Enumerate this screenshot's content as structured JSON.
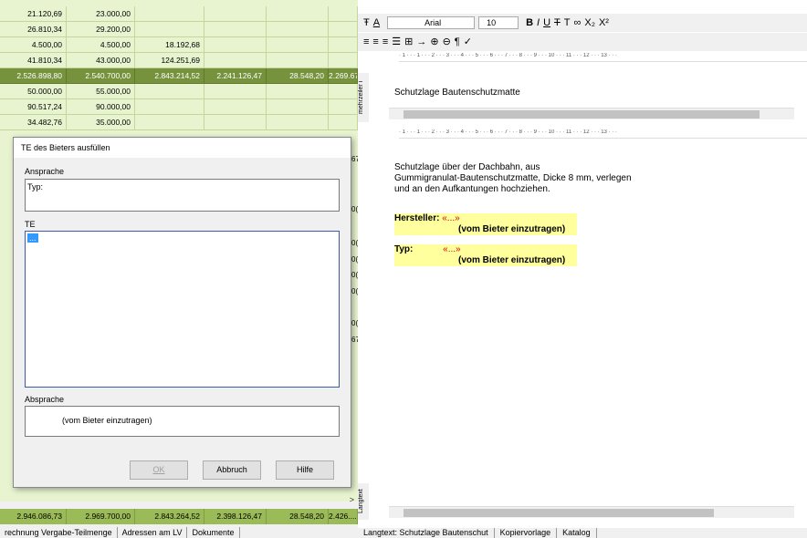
{
  "grid": {
    "rows": [
      {
        "cells": [
          "21.120,69",
          "23.000,00",
          "",
          "",
          "",
          ""
        ],
        "dark": false
      },
      {
        "cells": [
          "26.810,34",
          "29.200,00",
          "",
          "",
          "",
          ""
        ],
        "dark": false
      },
      {
        "cells": [
          "4.500,00",
          "4.500,00",
          "18.192,68",
          "",
          "",
          ""
        ],
        "dark": false
      },
      {
        "cells": [
          "41.810,34",
          "43.000,00",
          "124.251,69",
          "",
          "",
          ""
        ],
        "dark": false
      },
      {
        "cells": [
          "2.526.898,80",
          "2.540.700,00",
          "2.843.214,52",
          "2.241.126,47",
          "28.548,20",
          "2.269.67"
        ],
        "dark": true
      },
      {
        "cells": [
          "50.000,00",
          "55.000,00",
          "",
          "",
          "",
          ""
        ],
        "dark": false
      },
      {
        "cells": [
          "90.517,24",
          "90.000,00",
          "",
          "",
          "",
          ""
        ],
        "dark": false
      },
      {
        "cells": [
          "34.482,76",
          "35.000,00",
          "",
          "",
          "",
          ""
        ],
        "dark": false
      }
    ],
    "sum": [
      "2.946.086,73",
      "2.969.700,00",
      "2.843.264,52",
      "2.398.126,47",
      "28.548,20",
      "2.426...."
    ],
    "partial_right": [
      "67",
      "0(",
      "0(",
      "0(",
      "0(",
      "0(",
      "0(",
      "67"
    ],
    "bottom_tabs": [
      "rechnung Vergabe-Teilmenge",
      "Adressen am LV",
      "Dokumente"
    ]
  },
  "dialog": {
    "title": "TE des Bieters ausfüllen",
    "ansprache_label": "Ansprache",
    "ansprache_value": "Typ:",
    "te_label": "TE",
    "te_value": "...",
    "absprache_label": "Absprache",
    "absprache_value": "(vom Bieter einzutragen)",
    "ok_label": "OK",
    "cancel_label": "Abbruch",
    "help_label": "Hilfe"
  },
  "editor": {
    "font_name": "Arial",
    "font_size": "10",
    "toolbar1": [
      "T",
      "A",
      "▾",
      "Arial",
      "▾",
      "10",
      "▾",
      "B",
      "I",
      "U",
      "Ŧ",
      "T",
      "𝒪",
      "X₂",
      "X²"
    ],
    "mehrzeiler_label": "mehrzeiler i",
    "short_text": "Schutzlage Bautenschutzmatte",
    "langtext_label": "Langtext",
    "body_lines": [
      "Schutzlage über der Dachbahn, aus",
      "Gummigranulat-Bautenschutzmatte, Dicke 8 mm, verlegen",
      "und an den Aufkantungen hochziehen."
    ],
    "hersteller_label": "Hersteller:",
    "hersteller_value": "«...»",
    "hersteller_note": "(vom Bieter einzutragen)",
    "typ_label": "Typ:",
    "typ_value": "«...»",
    "typ_note": "(vom Bieter einzutragen)",
    "ruler_text": "· 1 · · · 1 · · · 2 · · · 3 · · · 4 · · · 5 · · · 6 · · · 7 · · · 8 · · · 9 · · · 10 · · · 11 · · · 12 · · · 13 · · ·",
    "bottom_tabs": [
      "Langtext: Schutzlage Bautenschut",
      "Kopiervorlage",
      "Katalog"
    ]
  },
  "colors": {
    "accent": "#76923c",
    "row": "#e8f4d0",
    "sum": "#9bbb59",
    "dialog_border": "#7a7a7a",
    "highlight": "#ffff9e",
    "red": "#dd0000"
  }
}
